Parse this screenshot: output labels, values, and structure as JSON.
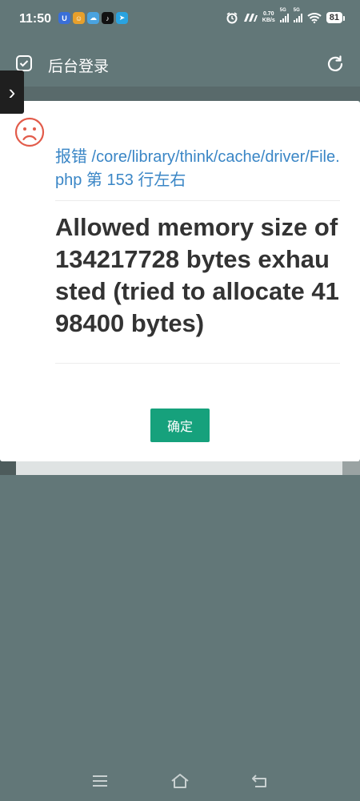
{
  "status_bar": {
    "time": "11:50",
    "net_speed": "0.70",
    "net_unit": "KB/s",
    "signal1_label": "5G",
    "signal2_label": "5G",
    "battery": "81",
    "app_icons": [
      {
        "name": "u-app-icon",
        "glyph": "U",
        "color": "#3a6fd8"
      },
      {
        "name": "game-app-icon",
        "glyph": "☺",
        "color": "#e7a02b"
      },
      {
        "name": "cloud-app-icon",
        "glyph": "☁",
        "color": "#4aa3e0"
      },
      {
        "name": "tiktok-icon",
        "glyph": "♪",
        "color": "#111111"
      },
      {
        "name": "telegram-icon",
        "glyph": "➤",
        "color": "#2aa3e0"
      }
    ]
  },
  "header": {
    "title": "后台登录"
  },
  "dialog": {
    "error_location": "报错 /core/library/think/cache/driver/File.php 第 153 行左右",
    "error_message": "Allowed memory size of 134217728 bytes exhausted (tried to allocate 4198400 bytes)",
    "confirm_label": "确定"
  },
  "colors": {
    "overlay": "#627778",
    "link": "#3a86c6",
    "button": "#16a17c",
    "sad_face": "#e25b4a"
  }
}
